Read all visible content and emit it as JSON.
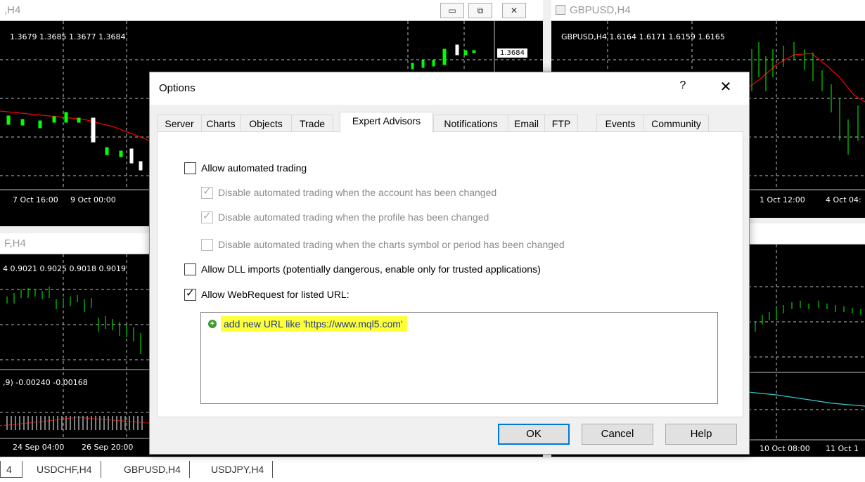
{
  "charts": {
    "top_left": {
      "title": ",H4",
      "ohlc": "1.3679 1.3685 1.3677 1.3684",
      "price_tag": "1.3684",
      "time_labels": [
        "7 Oct 16:00",
        "9 Oct 00:00"
      ]
    },
    "top_right": {
      "title": "GBPUSD,H4",
      "ohlc": "GBPUSD,H4  1.6164 1.6171 1.6159 1.6165",
      "time_labels": [
        "1 Oct 12:00",
        "4 Oct 04:"
      ]
    },
    "bottom_left": {
      "title": "F,H4",
      "ohlc": "4  0.9021 0.9025 0.9018 0.9019",
      "indicator": ",9) -0.00240 -0.00168",
      "time_labels": [
        "24 Sep 04:00",
        "26 Sep 20:00"
      ]
    },
    "bottom_right": {
      "time_labels": [
        "10 Oct 08:00",
        "11 Oct 1"
      ]
    },
    "window_buttons": {
      "minimize": "▭",
      "restore": "⧉",
      "close": "✕"
    }
  },
  "chart_tabs": [
    "4",
    "USDCHF,H4",
    "GBPUSD,H4",
    "USDJPY,H4"
  ],
  "dialog": {
    "title": "Options",
    "help": "?",
    "close": "✕",
    "tabs": [
      "Server",
      "Charts",
      "Objects",
      "Trade",
      "Expert Advisors",
      "Notifications",
      "Email",
      "FTP",
      "Events",
      "Community"
    ],
    "active_tab": "Expert Advisors",
    "options": {
      "allow_automated": {
        "label": "Allow automated trading",
        "checked": false
      },
      "disable_account": {
        "label": "Disable automated trading when the account has been changed",
        "checked": true
      },
      "disable_profile": {
        "label": "Disable automated trading when the profile has been changed",
        "checked": true
      },
      "disable_symbol": {
        "label": "Disable automated trading when the charts symbol or period has been changed",
        "checked": false
      },
      "allow_dll": {
        "label": "Allow DLL imports (potentially dangerous, enable only for trusted applications)",
        "checked": false
      },
      "allow_webrequest": {
        "label": "Allow WebRequest for listed URL:",
        "checked": true
      }
    },
    "url_list": {
      "hint": "add new URL like 'https://www.mql5.com'"
    },
    "buttons": {
      "ok": "OK",
      "cancel": "Cancel",
      "help": "Help"
    }
  },
  "colors": {
    "chart_bg": "#000000",
    "bull_candle": "#00ff00",
    "moving_average": "#ff0000",
    "highlight": "#ffff3a",
    "accent": "#0078d7"
  }
}
